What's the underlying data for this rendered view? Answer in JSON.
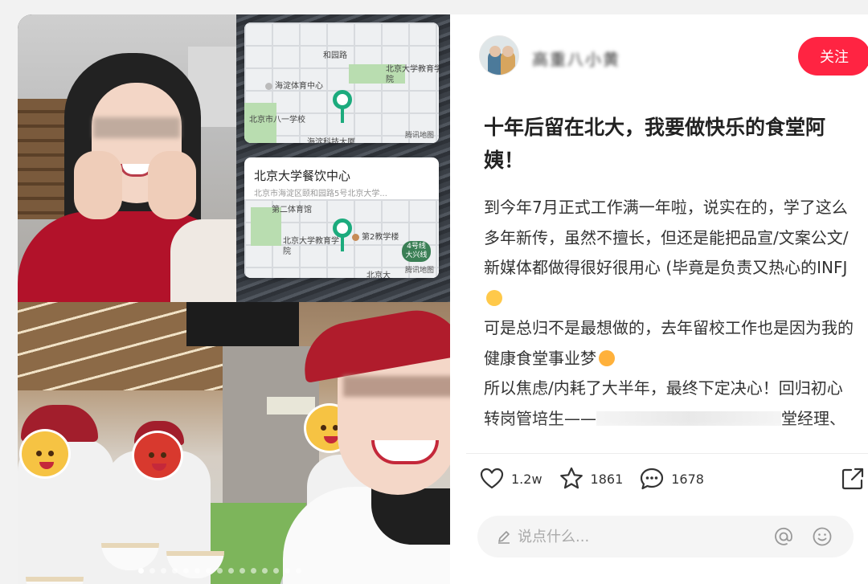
{
  "author": {
    "username": "高重八小黄",
    "avatar_alt": "avatar"
  },
  "follow_label": "关注",
  "map_cards": [
    {
      "title": "",
      "labels": [
        "和园路",
        "海淀体育中心",
        "北京大学教育学院",
        "北京市八一学校",
        "海淀科技大厦"
      ],
      "provider": "腾讯地图"
    },
    {
      "title": "北京大学餐饮中心",
      "address": "北京市海淀区颐和园路5号北京大学...",
      "labels": [
        "第二体育馆",
        "北京大学教育学院",
        "第2教学楼",
        "4号线大兴线",
        "北京大"
      ],
      "provider": "腾讯地图"
    }
  ],
  "post": {
    "title": "十年后留在北大，我要做快乐的食堂阿姨！",
    "paragraphs": [
      "到今年7月正式工作满一年啦，说实在的，学了这么多年新传，虽然不擅长，但还是能把品宣/文案公文/新媒体都做得很好很用心 (毕竟是负责又热心的INFJ",
      "可是总归不是最想做的，去年留校工作也是因为我的健康食堂事业梦",
      "所以焦虑/内耗了大半年，最终下定决心！回归初心转岗管培生——",
      "堂经理、"
    ]
  },
  "stats": {
    "likes": "1.2w",
    "collects": "1861",
    "comments": "1678"
  },
  "comment_placeholder": "说点什么...",
  "colors": {
    "accent": "#ff2442",
    "map_pin": "#1cab7d"
  },
  "icons": [
    "heart-icon",
    "star-icon",
    "comment-icon",
    "share-icon",
    "pencil-icon",
    "at-icon",
    "emoji-icon"
  ]
}
